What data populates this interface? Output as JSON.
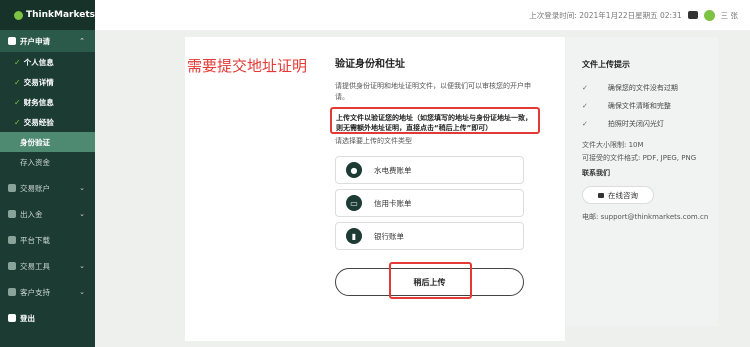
{
  "brand": "ThinkMarkets",
  "sidebar": {
    "section_open": "开户申请",
    "sub_items": [
      {
        "label": "个人信息"
      },
      {
        "label": "交易详情"
      },
      {
        "label": "财务信息"
      },
      {
        "label": "交易经验"
      },
      {
        "label": "身份验证"
      },
      {
        "label": "存入资金"
      }
    ],
    "sections": [
      {
        "label": "交易账户"
      },
      {
        "label": "出入金"
      },
      {
        "label": "平台下载"
      },
      {
        "label": "交易工具"
      },
      {
        "label": "客户支持"
      },
      {
        "label": "登出"
      }
    ]
  },
  "topbar": {
    "last_login": "上次登录时间: 2021年1月22日星期五 02:31",
    "user": "三 张"
  },
  "main": {
    "red_title": "需要提交地址证明",
    "title": "验证身份和住址",
    "desc": "请提供身份证明和地址证明文件，以便我们可以审核您的开户申请。",
    "highlight": "上传文件以验证您的地址（如您填写的地址与身份证地址一致，则无需额外地址证明，直接点击“稍后上传”即可）",
    "select_label": "请选择要上传的文件类型",
    "options": [
      {
        "label": "水电费账单"
      },
      {
        "label": "信用卡账单"
      },
      {
        "label": "银行账单"
      }
    ],
    "later_button": "稍后上传"
  },
  "right_panel": {
    "title": "文件上传提示",
    "tips": [
      "确保您的文件没有过期",
      "确保文件清晰和完整",
      "拍照时关闭闪光灯"
    ],
    "size_limit": "文件大小限制: 10M",
    "formats": "可接受的文件格式: PDF, JPEG, PNG",
    "contact": "联系我们",
    "chat_button": "在线咨询",
    "email": "电邮: support@thinkmarkets.com.cn"
  }
}
